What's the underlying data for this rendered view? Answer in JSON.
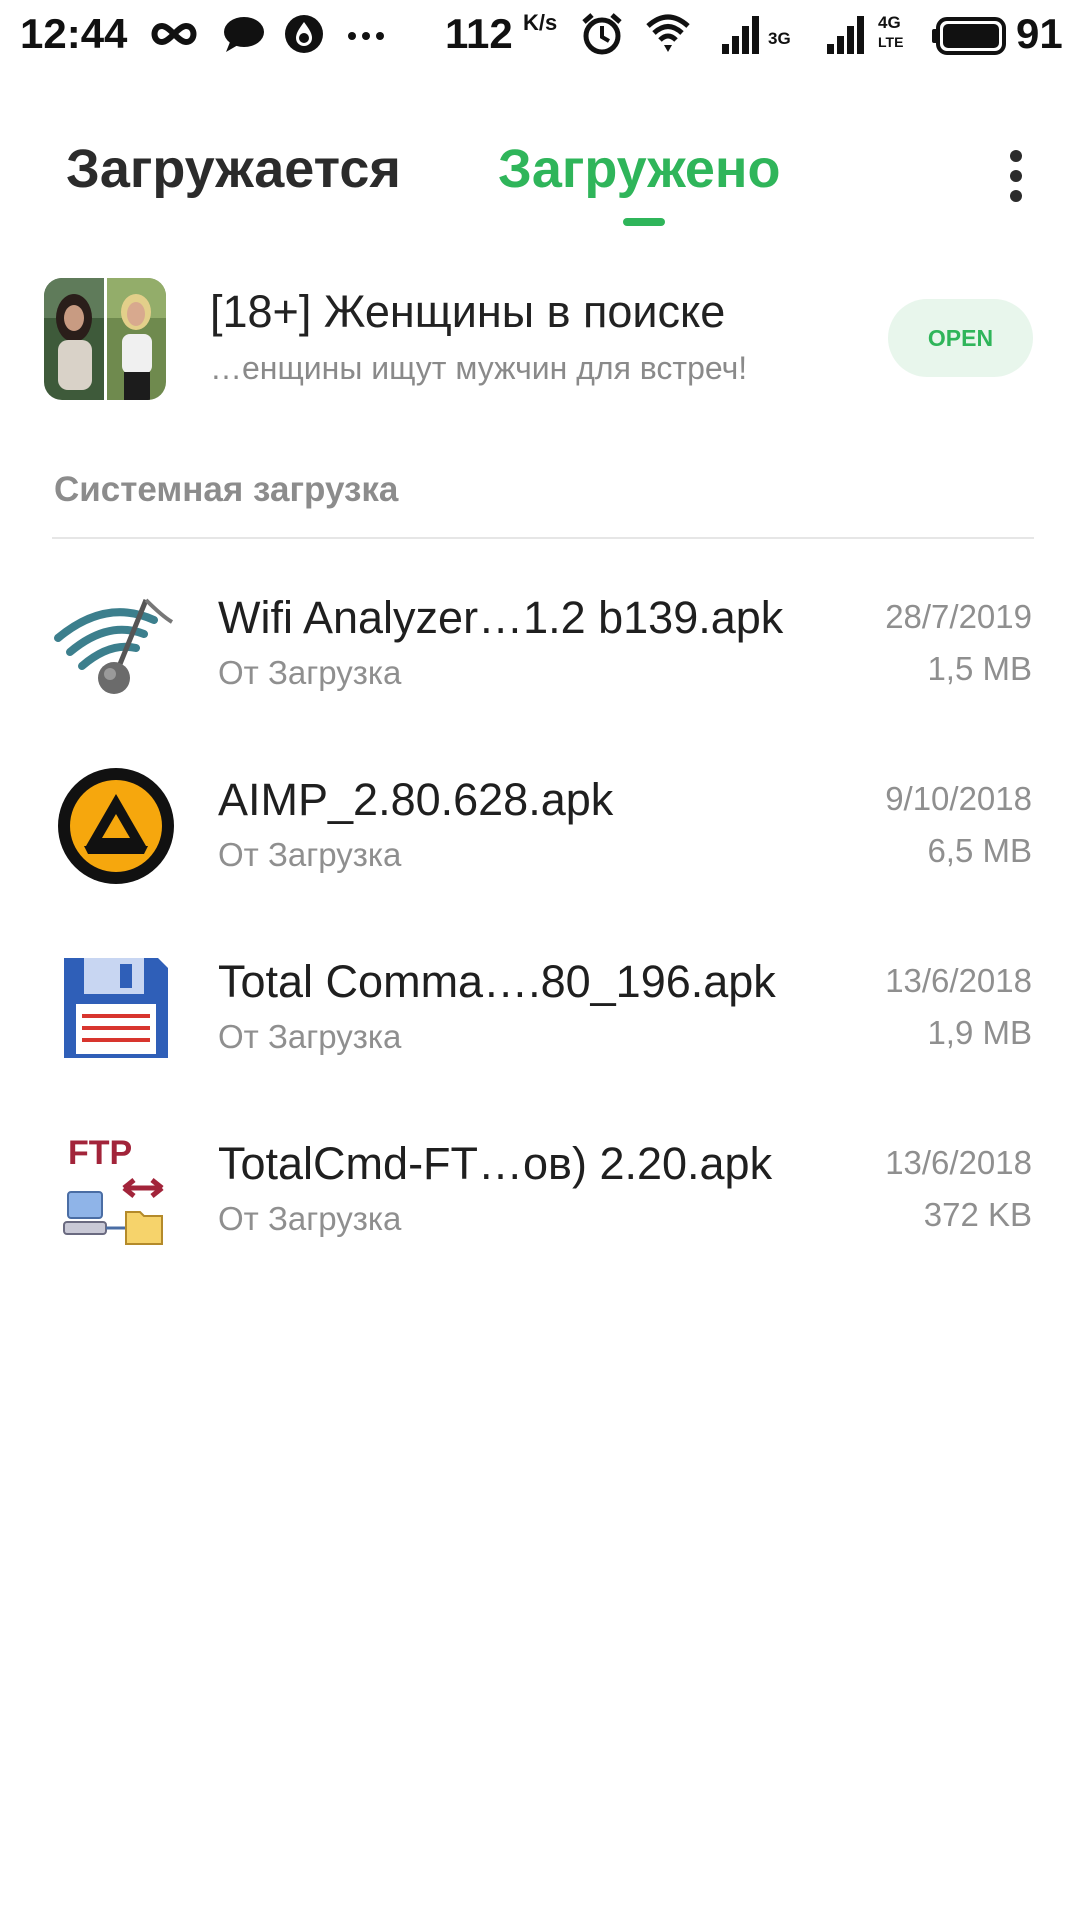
{
  "status_bar": {
    "time": "12:44",
    "speed": "112",
    "speed_unit": "K/s",
    "net1": "3G",
    "net2_top": "4G",
    "net2_bottom": "LTE",
    "battery": "91"
  },
  "tabs": [
    {
      "label": "Загружается",
      "active": false
    },
    {
      "label": "Загружено",
      "active": true
    }
  ],
  "accent_color": "#2fb55a",
  "promo": {
    "title": "[18+] Женщины в поиске",
    "subtitle": "…енщины ищут мужчин для встреч!",
    "button_label": "OPEN"
  },
  "section": {
    "title": "Системная загрузка"
  },
  "files": [
    {
      "name": "Wifi Analyzer…1.2 b139.apk",
      "source": "От Загрузка",
      "date": "28/7/2019",
      "size": "1,5 MB",
      "icon": "wifi-analyzer-icon"
    },
    {
      "name": "AIMP_2.80.628.apk",
      "source": "От Загрузка",
      "date": "9/10/2018",
      "size": "6,5 MB",
      "icon": "aimp-icon"
    },
    {
      "name": "Total Comma….80_196.apk",
      "source": "От Загрузка",
      "date": "13/6/2018",
      "size": "1,9 MB",
      "icon": "floppy-disk-icon"
    },
    {
      "name": "TotalCmd-FT…ов) 2.20.apk",
      "source": "От Загрузка",
      "date": "13/6/2018",
      "size": "372 KB",
      "icon": "ftp-plugin-icon",
      "icon_text": "FTP"
    }
  ]
}
